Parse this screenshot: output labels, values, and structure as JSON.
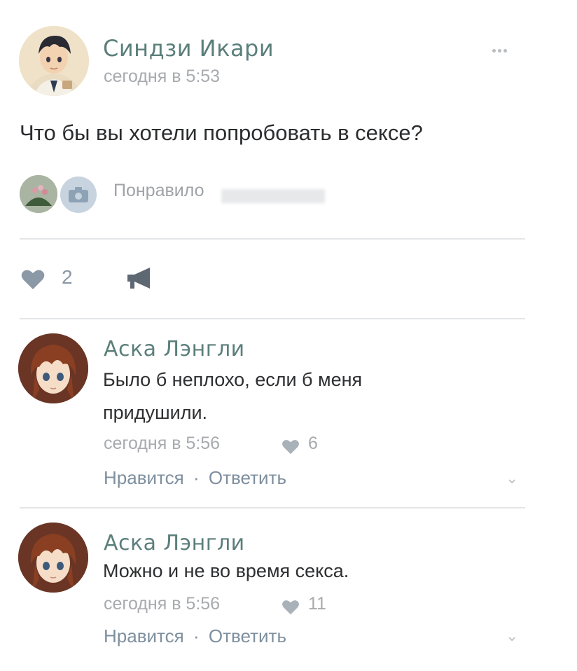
{
  "post": {
    "author": "Синдзи Икари",
    "time": "сегодня в 5:53",
    "text": "Что бы вы хотели попробовать в сексе?",
    "liked_by": "Понравило",
    "likes": "2"
  },
  "comments": [
    {
      "author": "Аска Лэнгли",
      "text_line1": "Было б неплохо, если б меня",
      "text_line2": "придушили.",
      "time": "сегодня в 5:56",
      "likes": "6",
      "like_label": "Нравится",
      "separator": "·",
      "reply_label": "Ответить"
    },
    {
      "author": "Аска Лэнгли",
      "text_line1": "Можно и не во время секса.",
      "time": "сегодня в 5:56",
      "likes": "11",
      "like_label": "Нравится",
      "separator": "·",
      "reply_label": "Ответить"
    }
  ],
  "colors": {
    "name": "#5b7f7b",
    "meta": "#a7aaae",
    "action": "#7e8f9e",
    "icon": "#8b98a5"
  }
}
